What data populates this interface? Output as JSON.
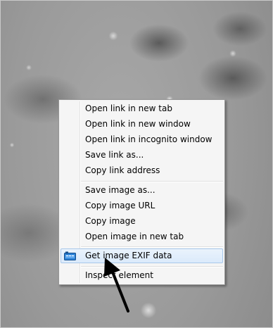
{
  "context_menu": {
    "link_items": [
      "Open link in new tab",
      "Open link in new window",
      "Open link in incognito window",
      "Save link as...",
      "Copy link address"
    ],
    "image_items": [
      "Save image as...",
      "Copy image URL",
      "Copy image",
      "Open image in new tab"
    ],
    "extension_item": {
      "label": "Get image EXIF data",
      "icon": "exif-camera-icon",
      "highlighted": true
    },
    "inspect_item": "Inspect element"
  },
  "colors": {
    "menu_bg": "#f5f5f5",
    "highlight_bg": "#dbeafb",
    "highlight_border": "#a9c8ea",
    "icon_blue": "#2a7fd4"
  }
}
